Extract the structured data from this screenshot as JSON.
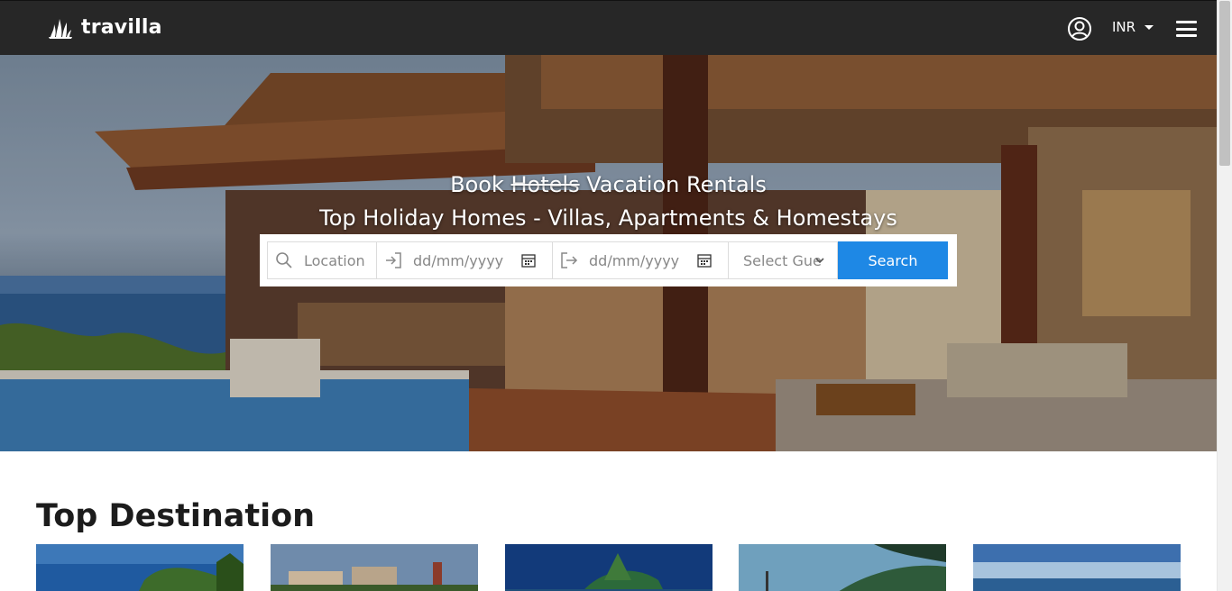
{
  "header": {
    "logo_text": "travilla",
    "currency": "INR",
    "account_icon": "user-circle-icon",
    "menu_icon": "hamburger-menu-icon"
  },
  "hero": {
    "title_prefix": "Book",
    "title_struck": "Hotels",
    "title_suffix": "Vacation Rentals",
    "subtitle": "Top Holiday Homes - Villas, Apartments & Homestays"
  },
  "search": {
    "location_placeholder": "Location",
    "checkin_placeholder": "dd/mm/yyyy",
    "checkout_placeholder": "dd/mm/yyyy",
    "guests_placeholder": "Select Gue",
    "button_label": "Search",
    "accent_color": "#1e88e5"
  },
  "top_destination": {
    "title": "Top Destination",
    "card_count_visible": 5
  }
}
